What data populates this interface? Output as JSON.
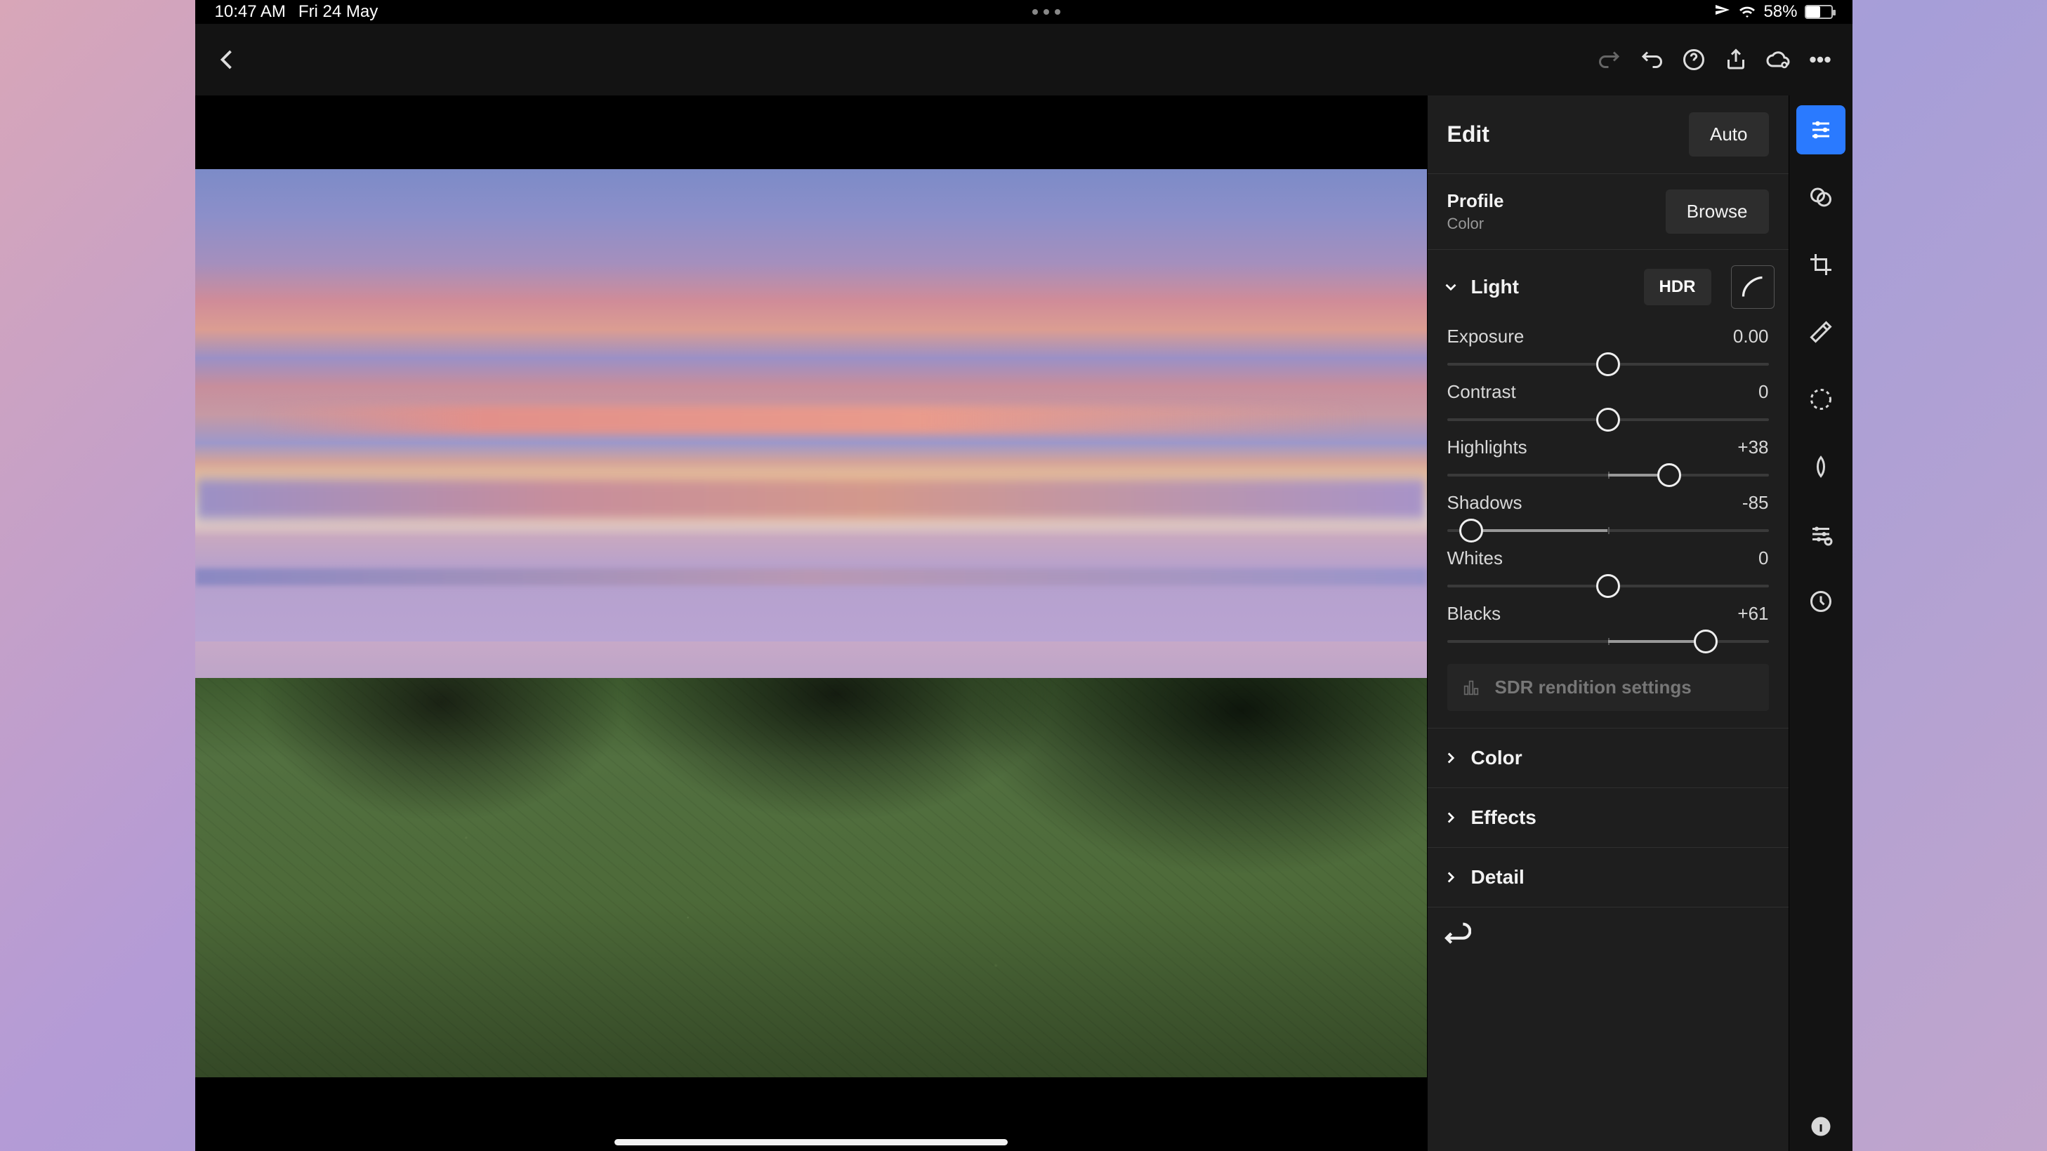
{
  "status": {
    "time": "10:47 AM",
    "date": "Fri 24 May",
    "battery_pct": "58%"
  },
  "panel": {
    "title": "Edit",
    "auto": "Auto",
    "profile_label": "Profile",
    "profile_value": "Color",
    "browse": "Browse",
    "light_label": "Light",
    "hdr": "HDR",
    "sliders": {
      "exposure": {
        "label": "Exposure",
        "value": "0.00",
        "pct": 50
      },
      "contrast": {
        "label": "Contrast",
        "value": "0",
        "pct": 50
      },
      "highlights": {
        "label": "Highlights",
        "value": "+38",
        "pct": 69
      },
      "shadows": {
        "label": "Shadows",
        "value": "-85",
        "pct": 7.5
      },
      "whites": {
        "label": "Whites",
        "value": "0",
        "pct": 50
      },
      "blacks": {
        "label": "Blacks",
        "value": "+61",
        "pct": 80.5
      }
    },
    "sdr": "SDR rendition settings",
    "sections": {
      "color": "Color",
      "effects": "Effects",
      "detail": "Detail"
    }
  }
}
